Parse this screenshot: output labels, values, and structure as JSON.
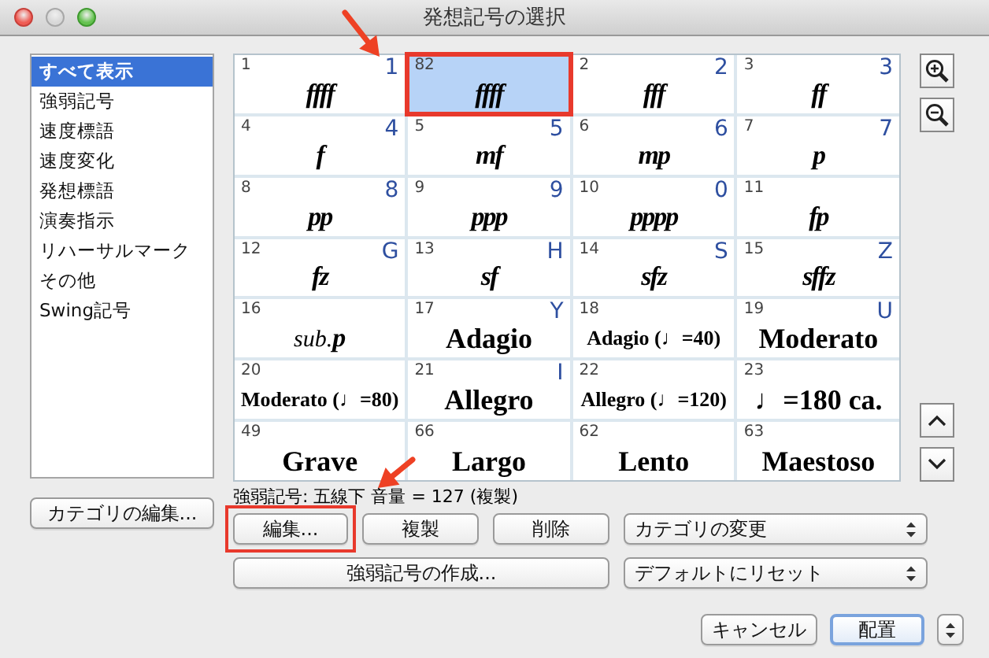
{
  "window": {
    "title": "発想記号の選択"
  },
  "categories": [
    {
      "label": "すべて表示",
      "selected": true
    },
    {
      "label": "強弱記号",
      "selected": false
    },
    {
      "label": "速度標語",
      "selected": false
    },
    {
      "label": "速度変化",
      "selected": false
    },
    {
      "label": "発想標語",
      "selected": false
    },
    {
      "label": "演奏指示",
      "selected": false
    },
    {
      "label": "リハーサルマーク",
      "selected": false
    },
    {
      "label": "その他",
      "selected": false
    },
    {
      "label": "Swing記号",
      "selected": false
    }
  ],
  "edit_category_button": "カテゴリの編集...",
  "symbols": [
    {
      "number": "1",
      "shortcut": "1",
      "text": "ffff",
      "kind": "dynamic",
      "selected": false
    },
    {
      "number": "82",
      "text": "ffff",
      "kind": "dynamic",
      "selected": true,
      "highlighted": true,
      "pointer": true
    },
    {
      "number": "2",
      "shortcut": "2",
      "text": "fff",
      "kind": "dynamic",
      "selected": false
    },
    {
      "number": "3",
      "shortcut": "3",
      "text": "ff",
      "kind": "dynamic",
      "selected": false
    },
    {
      "number": "4",
      "shortcut": "4",
      "text": "f",
      "kind": "dynamic",
      "selected": false
    },
    {
      "number": "5",
      "shortcut": "5",
      "text": "mf",
      "kind": "dynamic",
      "selected": false
    },
    {
      "number": "6",
      "shortcut": "6",
      "text": "mp",
      "kind": "dynamic",
      "selected": false
    },
    {
      "number": "7",
      "shortcut": "7",
      "text": "p",
      "kind": "dynamic",
      "selected": false
    },
    {
      "number": "8",
      "shortcut": "8",
      "text": "pp",
      "kind": "dynamic",
      "selected": false
    },
    {
      "number": "9",
      "shortcut": "9",
      "text": "ppp",
      "kind": "dynamic",
      "selected": false
    },
    {
      "number": "10",
      "shortcut": "0",
      "text": "pppp",
      "kind": "dynamic",
      "selected": false
    },
    {
      "number": "11",
      "text": "fp",
      "kind": "dynamic",
      "selected": false
    },
    {
      "number": "12",
      "shortcut": "G",
      "text": "fz",
      "kind": "dynamic",
      "selected": false
    },
    {
      "number": "13",
      "shortcut": "H",
      "text": "sf",
      "kind": "dynamic",
      "selected": false
    },
    {
      "number": "14",
      "shortcut": "S",
      "text": "sfz",
      "kind": "dynamic",
      "selected": false
    },
    {
      "number": "15",
      "shortcut": "Z",
      "text": "sffz",
      "kind": "dynamic",
      "selected": false
    },
    {
      "number": "16",
      "text": "sub.**p**",
      "kind": "expression",
      "selected": false
    },
    {
      "number": "17",
      "shortcut": "Y",
      "text": "Adagio",
      "kind": "tempo",
      "selected": false
    },
    {
      "number": "18",
      "text": "Adagio (♩=40)",
      "kind": "tempo",
      "selected": false
    },
    {
      "number": "19",
      "shortcut": "U",
      "text": "Moderato",
      "kind": "tempo",
      "selected": false
    },
    {
      "number": "20",
      "text": "Moderato (♩=80)",
      "kind": "tempo",
      "selected": false
    },
    {
      "number": "21",
      "shortcut": "I",
      "text": "Allegro",
      "kind": "tempo",
      "selected": false
    },
    {
      "number": "22",
      "text": "Allegro (♩=120)",
      "kind": "tempo",
      "selected": false
    },
    {
      "number": "23",
      "text": "♩=180 ca.",
      "kind": "tempo",
      "selected": false
    },
    {
      "number": "49",
      "text": "Grave",
      "kind": "tempo",
      "selected": false
    },
    {
      "number": "66",
      "text": "Largo",
      "kind": "tempo",
      "selected": false
    },
    {
      "number": "62",
      "text": "Lento",
      "kind": "tempo",
      "selected": false
    },
    {
      "number": "63",
      "text": "Maestoso",
      "kind": "tempo",
      "selected": false
    }
  ],
  "status": "強弱記号: 五線下 音量 = 127 (複製)",
  "actions": [
    {
      "kind": "button",
      "label": "編集...",
      "highlighted": true,
      "pointer": true
    },
    {
      "kind": "button",
      "label": "複製"
    },
    {
      "kind": "button",
      "label": "削除"
    },
    {
      "kind": "popup",
      "label": "カテゴリの変更"
    },
    {
      "kind": "button",
      "label": "強弱記号の作成..."
    },
    {
      "kind": "popup",
      "label": "デフォルトにリセット"
    }
  ],
  "footer": [
    {
      "kind": "button",
      "label": "キャンセル",
      "default": false
    },
    {
      "kind": "button",
      "label": "配置",
      "default": true
    },
    {
      "kind": "stepper"
    }
  ]
}
